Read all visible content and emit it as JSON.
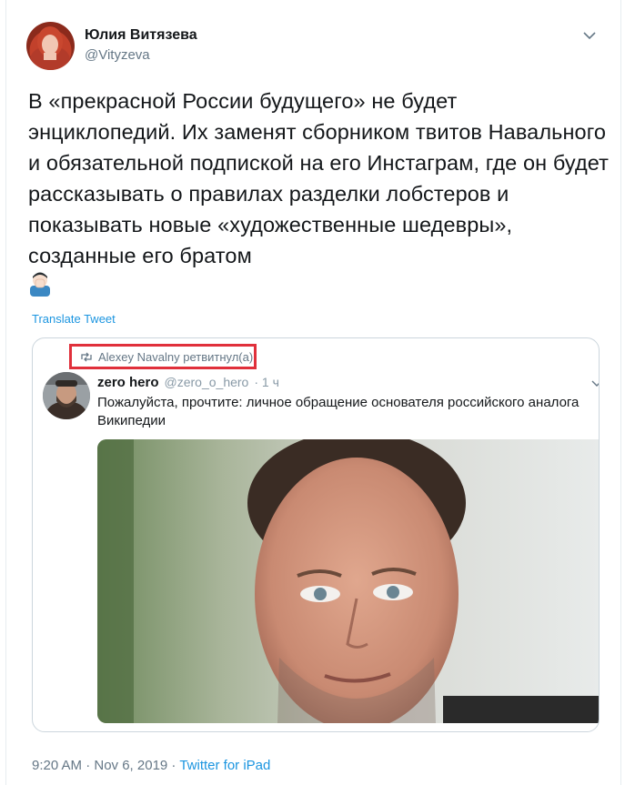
{
  "tweet": {
    "author_name": "Юлия Витязева",
    "author_handle": "@Vityzeva",
    "text": "В «прекрасной России будущего» не будет энциклопедий. Их заменят сборником твитов Навального и обязательной подпиской на его Инстаграм, где он будет рассказывать о правилах разделки лобстеров и показывать новые «художественные шедевры», созданные его братом",
    "emoji": "man-facepalming-icon",
    "translate_label": "Translate Tweet",
    "timestamp": "9:20 AM · Nov 6, 2019",
    "separator": " · ",
    "source": "Twitter for iPad"
  },
  "quoted": {
    "retweet_line": "Alexey Navalny ретвитнул(а)",
    "author_name": "zero hero",
    "author_handle": "@zero_o_hero",
    "age": "· 1 ч",
    "text": "Пожалуйста, прочтите: личное обращение основателя российского аналога Википедии"
  },
  "colors": {
    "accent": "#1b95e0",
    "highlight_box": "#e0303b",
    "secondary_text": "#657786"
  }
}
